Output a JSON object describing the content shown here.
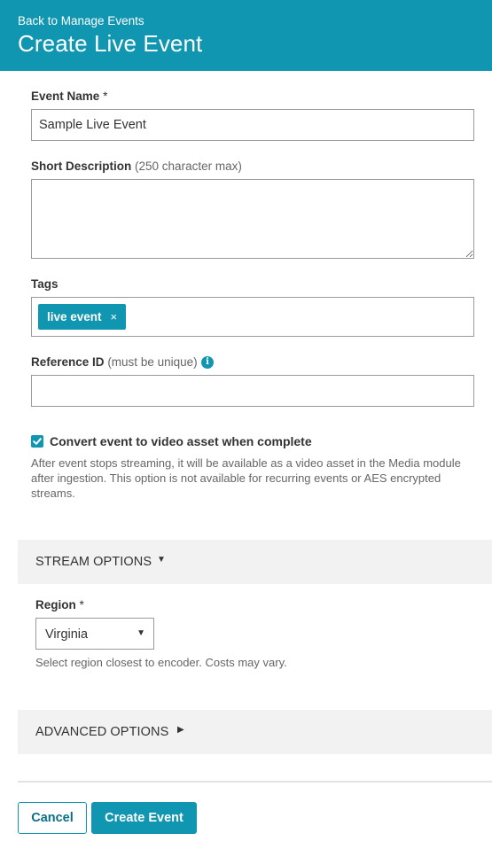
{
  "header": {
    "back_link": "Back to Manage Events",
    "title": "Create Live Event",
    "color": "#1096b1"
  },
  "form": {
    "event_name": {
      "label": "Event Name",
      "required_mark": "*",
      "value": "Sample Live Event"
    },
    "short_description": {
      "label": "Short Description",
      "hint": "(250 character max)",
      "value": ""
    },
    "tags": {
      "label": "Tags",
      "items": [
        {
          "label": "live event",
          "remove": "×"
        }
      ]
    },
    "reference_id": {
      "label": "Reference ID",
      "hint": "(must be unique)",
      "info_icon": "i",
      "value": ""
    },
    "convert_asset": {
      "checked": true,
      "label": "Convert event to video asset when complete",
      "help": "After event stops streaming, it will be available as a video asset in the Media module after ingestion. This option is not available for recurring events or AES encrypted streams."
    }
  },
  "stream_options": {
    "title": "STREAM OPTIONS",
    "arrow": "▼",
    "region": {
      "label": "Region",
      "required_mark": "*",
      "value": "Virginia",
      "arrow": "▼",
      "help": "Select region closest to encoder. Costs may vary."
    }
  },
  "advanced_options": {
    "title": "ADVANCED OPTIONS",
    "arrow": "▶"
  },
  "footer": {
    "cancel_label": "Cancel",
    "create_label": "Create Event"
  }
}
